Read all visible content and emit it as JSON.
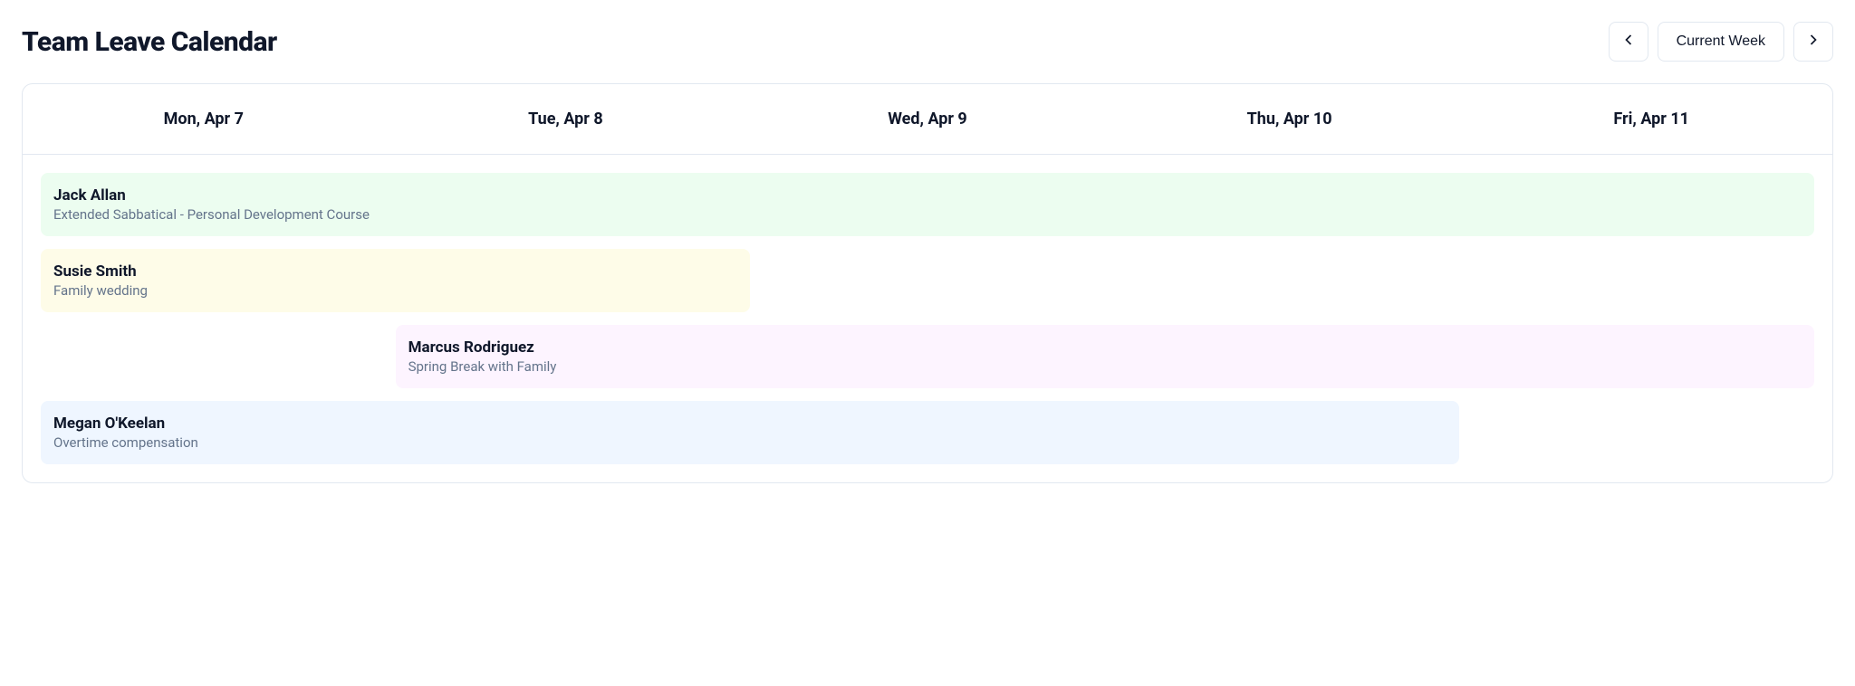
{
  "header": {
    "title": "Team Leave Calendar",
    "current_week_label": "Current Week"
  },
  "days": [
    "Mon, Apr 7",
    "Tue, Apr 8",
    "Wed, Apr 9",
    "Thu, Apr 10",
    "Fri, Apr 11"
  ],
  "events": [
    {
      "name": "Jack Allan",
      "desc": "Extended Sabbatical - Personal Development Course",
      "start": 1,
      "span": 5,
      "color": "green"
    },
    {
      "name": "Susie Smith",
      "desc": "Family wedding",
      "start": 1,
      "span": 2,
      "color": "yellow"
    },
    {
      "name": "Marcus Rodriguez",
      "desc": "Spring Break with Family",
      "start": 2,
      "span": 4,
      "color": "pink"
    },
    {
      "name": "Megan O'Keelan",
      "desc": "Overtime compensation",
      "start": 1,
      "span": 4,
      "color": "blue"
    }
  ]
}
